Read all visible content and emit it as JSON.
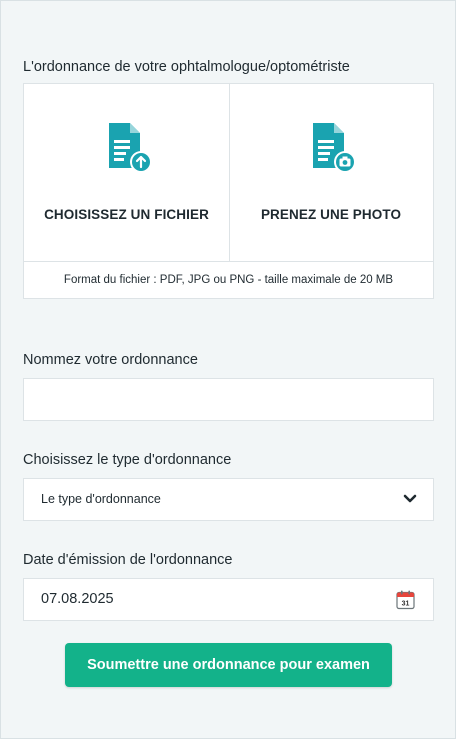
{
  "prescription_label": "L'ordonnance de votre ophtalmologue/optométriste",
  "upload": {
    "file_label": "CHOISISSEZ UN FICHIER",
    "photo_label": "PRENEZ UNE PHOTO",
    "format_note": "Format du fichier : PDF, JPG ou PNG - taille maximale de 20 MB",
    "icon_color": "#1aa3b0"
  },
  "name_field": {
    "label": "Nommez votre ordonnance",
    "value": ""
  },
  "type_field": {
    "label": "Choisissez le type d'ordonnance",
    "selected": "Le type d'ordonnance"
  },
  "date_field": {
    "label": "Date d'émission de l'ordonnance",
    "value": "07.08.2025",
    "calendar_day": "31"
  },
  "submit_label": "Soumettre une ordonnance pour examen",
  "colors": {
    "accent": "#13b28a",
    "background": "#f2f6f7"
  }
}
